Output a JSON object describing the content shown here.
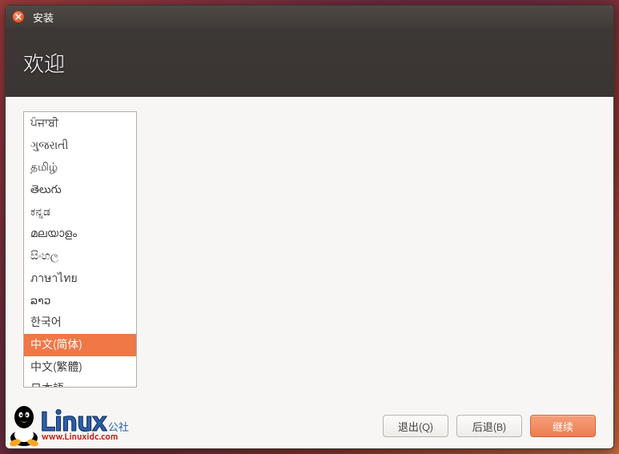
{
  "window": {
    "title": "安装"
  },
  "header": {
    "title": "欢迎"
  },
  "languages": [
    "ਪੰਜਾਬੀ",
    "ગુજરાતી",
    "தமிழ்",
    "తెలుగు",
    "ಕನ್ನಡ",
    "മലയാളം",
    "සිංහල",
    "ภาษาไทย",
    "ລາວ",
    "한국어",
    "中文(简体)",
    "中文(繁體)",
    "日本語"
  ],
  "selected_language_index": 10,
  "buttons": {
    "quit": "退出(Q)",
    "back": "后退(B)",
    "continue": "继续"
  },
  "watermark": {
    "brand": "Linux",
    "suffix": "公社",
    "url": "www.Linuxidc.com"
  }
}
